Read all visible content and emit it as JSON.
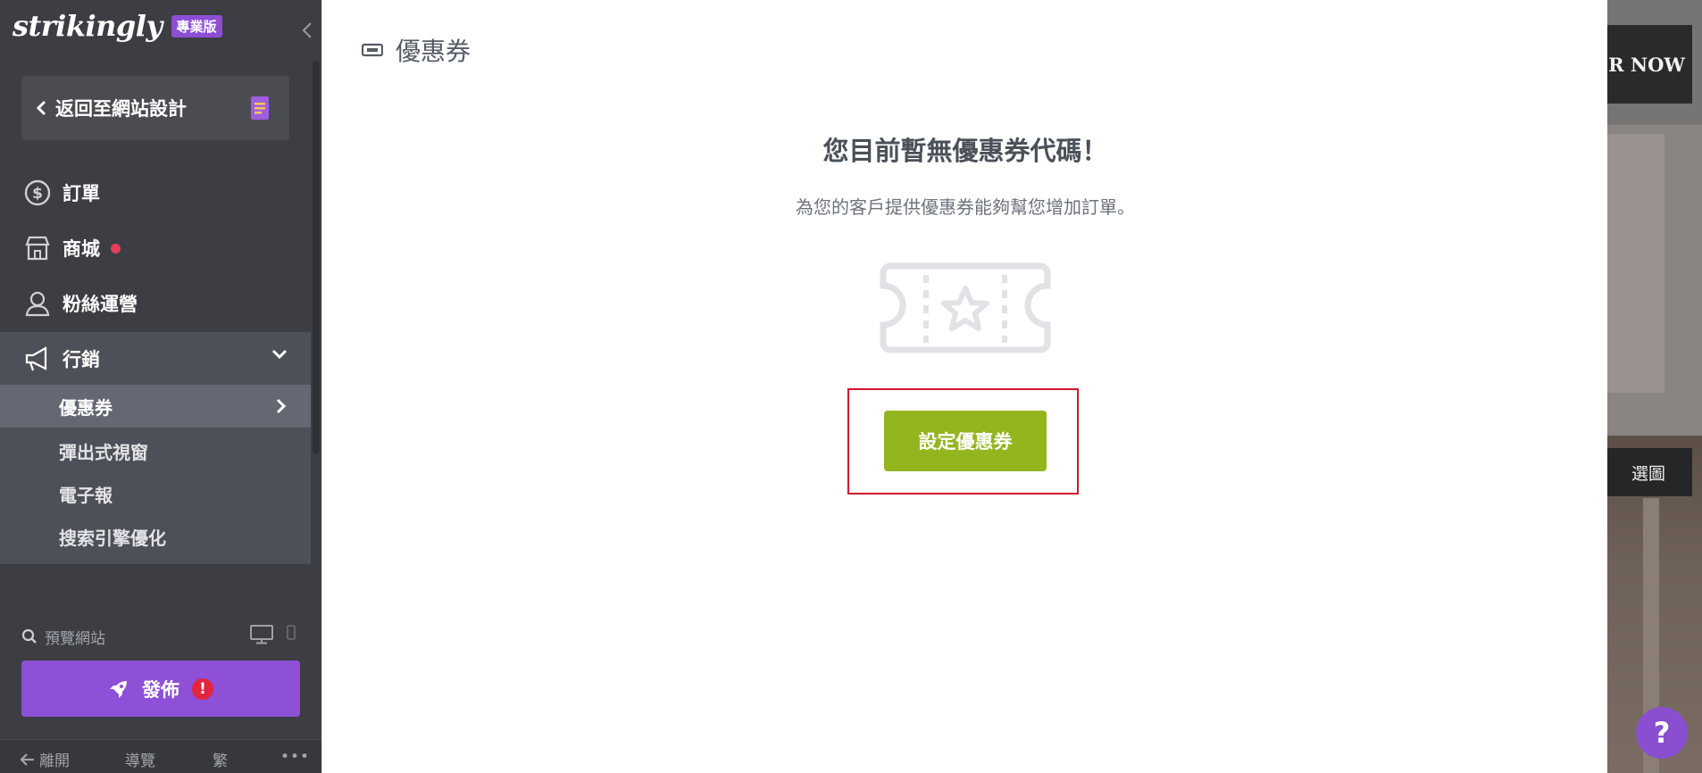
{
  "sidebar": {
    "logo": "strikingly",
    "pro_badge": "專業版",
    "back_link": "返回至網站設計",
    "nav": [
      {
        "label": "訂單"
      },
      {
        "label": "商城"
      },
      {
        "label": "粉絲運營"
      },
      {
        "label": "行銷"
      }
    ],
    "marketing_sub": [
      {
        "label": "優惠券"
      },
      {
        "label": "彈出式視窗"
      },
      {
        "label": "電子報"
      },
      {
        "label": "搜索引擎優化"
      }
    ],
    "preview_label": "預覽網站",
    "publish_label": "發佈",
    "publish_warning": "!",
    "bottom": {
      "leave": "離開",
      "tour": "導覽",
      "lang": "繁",
      "more": "•••"
    }
  },
  "main": {
    "page_title": "優惠券",
    "empty_title": "您目前暫無優惠券代碼！",
    "empty_sub": "為您的客戶提供優惠券能夠幫您增加訂單。",
    "cta_label": "設定優惠券"
  },
  "site_preview": {
    "order_btn": "R NOW",
    "mid_btn": "選圖"
  },
  "help_label": "?",
  "colors": {
    "sidebar_bg": "#3c3e43",
    "accent_purple": "#8d50d6",
    "cta_green": "#93b51e",
    "notification_red": "#e63e5a",
    "highlight_red": "#d0142c"
  }
}
